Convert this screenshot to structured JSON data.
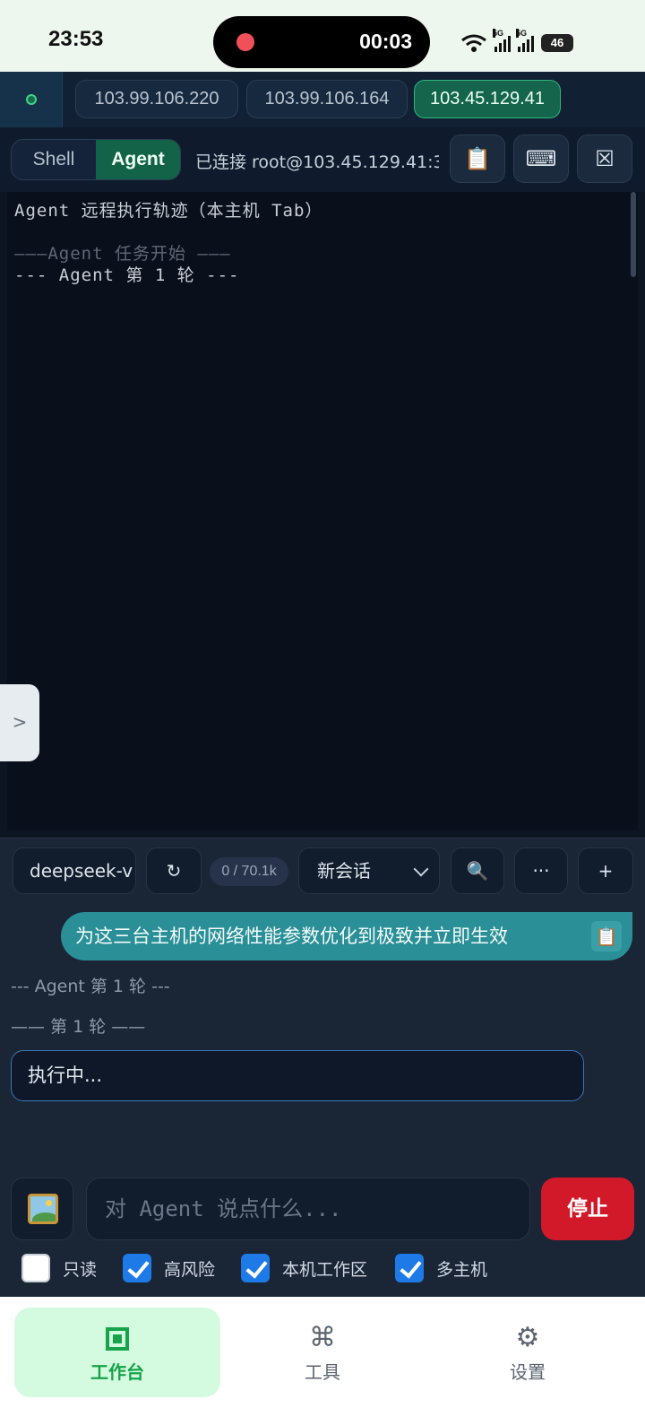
{
  "status_bar": {
    "time": "23:53",
    "recording_time": "00:03",
    "network_tag_1": "5G",
    "network_tag_2": "5G",
    "battery": "46"
  },
  "hosts": {
    "tabs": [
      {
        "label": "103.99.106.220",
        "active": false
      },
      {
        "label": "103.99.106.164",
        "active": false
      },
      {
        "label": "103.45.129.41",
        "active": true
      }
    ]
  },
  "terminal_header": {
    "modes": [
      "Shell",
      "Agent"
    ],
    "active_mode": "Agent",
    "connection_status": "已连接 root@103.45.129.41:3...",
    "buttons": {
      "copy": "📋",
      "keyboard": "⌨",
      "close": "☒"
    }
  },
  "terminal": {
    "lines": [
      "Agent 远程执行轨迹（本主机 Tab）",
      "———Agent 任务开始 ———",
      "--- Agent 第 1 轮 ---"
    ],
    "side_handle": ">"
  },
  "agent_panel": {
    "model_select": "deepseek-v",
    "refresh_icon": "↻",
    "token_usage": "0 / 70.1k",
    "session_select": "新会话",
    "search_icon": "🔍",
    "more_label": "···",
    "add_label": "+",
    "user_message": "为这三台主机的网络性能参数优化到极致并立即生效",
    "copy_icon": "📋",
    "log_round": "--- Agent 第 1 轮 ---",
    "log_divider": "—— 第 1 轮 ——",
    "executing": "执行中...",
    "input_placeholder": "对 Agent 说点什么...",
    "stop_label": "停止",
    "options": [
      {
        "label": "只读",
        "checked": false
      },
      {
        "label": "高风险",
        "checked": true
      },
      {
        "label": "本机工作区",
        "checked": true
      },
      {
        "label": "多主机",
        "checked": true
      }
    ]
  },
  "bottom_nav": {
    "items": [
      {
        "label": "工作台",
        "icon": "workbench-icon",
        "active": true
      },
      {
        "label": "工具",
        "icon": "⌘",
        "active": false
      },
      {
        "label": "设置",
        "icon": "⚙",
        "active": false
      }
    ]
  },
  "colors": {
    "accent_green": "#136348",
    "stop_red": "#d2192a",
    "user_bubble": "#2a8f96",
    "checkbox_blue": "#1e7ae6"
  }
}
